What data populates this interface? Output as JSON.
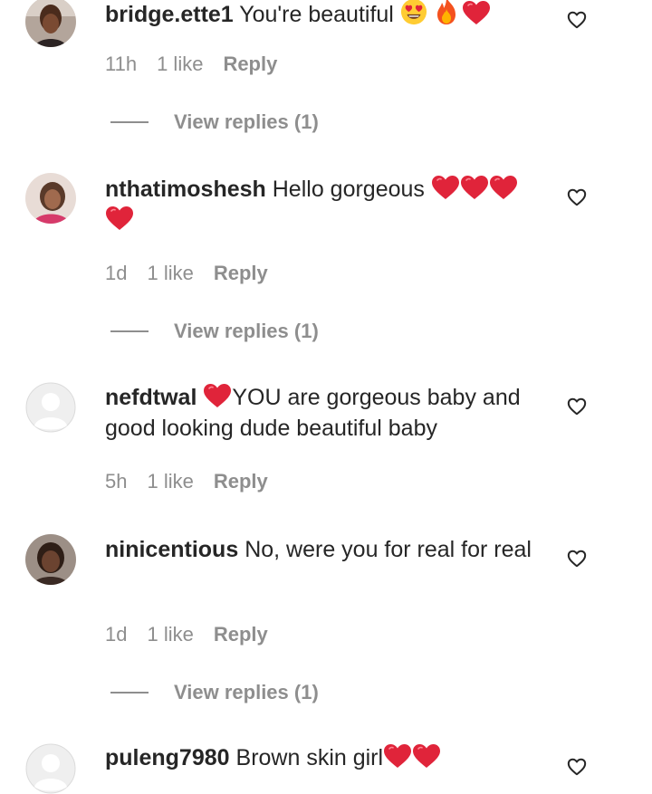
{
  "comments": [
    {
      "username": "bridge.ette1",
      "text": "You're beautiful",
      "emojis": [
        "heart-eyes-emoji",
        "fire-emoji",
        "red-heart-emoji"
      ],
      "time": "11h",
      "likes": "1 like",
      "reply": "Reply",
      "view_replies": "View replies (1)"
    },
    {
      "username": "nthatimoshesh",
      "text": "Hello gorgeous",
      "emojis": [
        "red-heart-emoji",
        "red-heart-emoji",
        "red-heart-emoji",
        "red-heart-emoji"
      ],
      "time": "1d",
      "likes": "1 like",
      "reply": "Reply",
      "view_replies": "View replies (1)"
    },
    {
      "username": "nefdtwal",
      "text": "YOU are gorgeous baby and good looking dude beautiful baby",
      "emojis": [
        "red-heart-emoji"
      ],
      "time": "5h",
      "likes": "1 like",
      "reply": "Reply"
    },
    {
      "username": "ninicentious",
      "text": "No, were you for real for real",
      "time": "1d",
      "likes": "1 like",
      "reply": "Reply",
      "view_replies": "View replies (1)"
    },
    {
      "username": "puleng7980",
      "text": "Brown skin girl",
      "emojis": [
        "red-heart-emoji",
        "red-heart-emoji"
      ]
    }
  ],
  "colors": {
    "text": "#262626",
    "muted": "#8e8e8e",
    "heart": "#e0243a"
  },
  "icons": {
    "like": "heart-outline-icon"
  }
}
